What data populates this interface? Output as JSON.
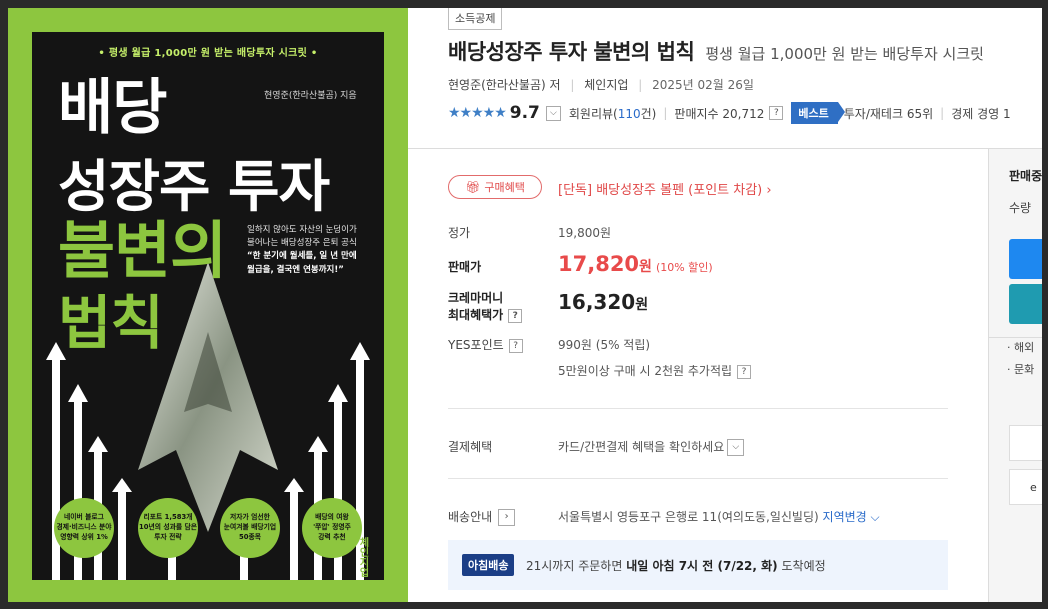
{
  "cover": {
    "tagline": "• 평생 월급 1,000만 원 받는 배당투자 시크릿 •",
    "author": "현영준(한라산불곰) 지음",
    "title_lines": [
      "배당",
      "성장주 투자",
      "불변의",
      "법칙"
    ],
    "desc_lines": [
      "일하지 않아도 자산의 눈덩이가",
      "불어나는 배당성장주 은퇴 공식"
    ],
    "quote_lines": [
      "“한 분기에 월세를, 일 년 만에",
      "월급을, 결국엔 연봉까지!”"
    ],
    "badges": [
      "네이버 블로그\n경제·비즈니스 분야\n영향력 상위 1%",
      "리포트 1,583개\n10년의 성과를 담은\n투자 전략",
      "저자가 엄선한\n눈여겨볼 배당기업\n50종목",
      "배당의 여왕\n'쭈압' 정영주\n강력 추천"
    ],
    "publisher": "체인지업"
  },
  "product": {
    "category_tag": "소득공제",
    "title": "배당성장주 투자 불변의 법칙",
    "subtitle": "평생 월급 1,000만 원 받는 배당투자 시크릿",
    "author": "현영준(한라산불곰)",
    "author_role": "저",
    "publisher": "체인지업",
    "date": "2025년 02월 26일",
    "stars": "★★★★★",
    "score": "9.7",
    "review_label": "회원리뷰(",
    "review_count": "110",
    "review_suffix": "건)",
    "sales_index_label": "판매지수 20,712",
    "best_label": "베스트",
    "rank_1": "투자/재테크 65위",
    "rank_2": "경제 경영 1"
  },
  "benefit": {
    "button": "구매혜택",
    "link": "[단독] 배당성장주 볼펜 (포인트 차감)"
  },
  "price": {
    "list_label": "정가",
    "list_value": "19,800원",
    "sale_label": "판매가",
    "sale_value": "17,820",
    "sale_unit": "원",
    "discount": "(10% 할인)",
    "crema_label_1": "크레마머니",
    "crema_label_2": "최대혜택가",
    "crema_value": "16,320",
    "crema_unit": "원",
    "points_label": "YES포인트",
    "points_value": "990원 (5% 적립)",
    "points_extra": "5만원이상 구매 시 2천원 추가적립"
  },
  "payment": {
    "label": "결제혜택",
    "value": "카드/간편결제 혜택을 확인하세요"
  },
  "shipping": {
    "label": "배송안내",
    "address": "서울특별시 영등포구 은행로 11(여의도동,일신빌딩)",
    "change": "지역변경",
    "morning_badge": "아침배송",
    "morning_pre": "21시까지 주문하면 ",
    "morning_bold": "내일 아침 7시 전 (7/22, 화)",
    "morning_post": " 도착예정"
  },
  "side_panel": {
    "title": "판매중",
    "qty_label": "수량",
    "links": [
      "· 해외",
      "· 문화"
    ],
    "box_text": "e"
  },
  "colors": {
    "cover_green": "#8dc63f",
    "cover_dark": "#141414",
    "price_red": "#e84a4a",
    "best_blue": "#2f6fc4",
    "link_blue": "#2a6bc9",
    "morning_navy": "#1b3e86"
  }
}
